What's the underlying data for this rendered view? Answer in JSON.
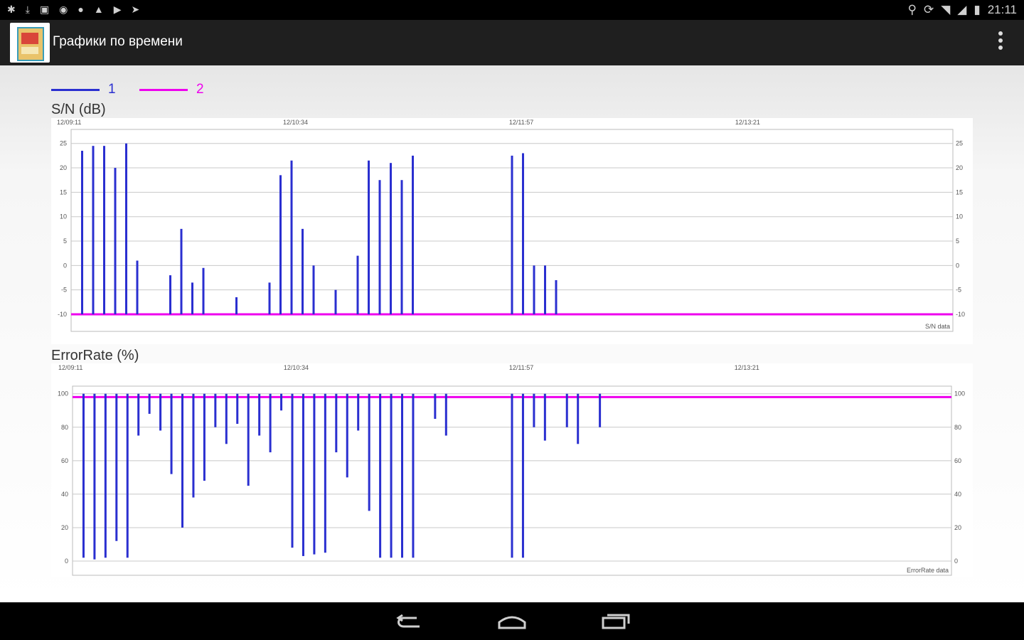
{
  "statusbar": {
    "time": "21:11",
    "left_icons": [
      "tools-icon",
      "download-icon",
      "app-icon",
      "gesture-icon",
      "dot-icon",
      "warning-icon",
      "play-icon",
      "send-icon"
    ],
    "right_icons": [
      "location-icon",
      "rotate-icon",
      "wifi-icon",
      "signal-icon",
      "battery-icon"
    ]
  },
  "appbar": {
    "title": "Графики по времени"
  },
  "legend": [
    {
      "label": "1",
      "color": "#2a2fd0"
    },
    {
      "label": "2",
      "color": "#ee00ee"
    }
  ],
  "colors": {
    "series1": "#2a2fd0",
    "series2": "#ee00ee"
  },
  "chart_data": [
    {
      "type": "bar",
      "title": "S/N (dB)",
      "footer_label": "S/N data",
      "time_labels": [
        "12/09:11",
        "12/10:34",
        "12/11:57",
        "12/13:21"
      ],
      "ylim": [
        -10,
        27
      ],
      "yticks": [
        25,
        20,
        15,
        10,
        5,
        0,
        -5,
        -10
      ],
      "ytick_labels": [
        "25",
        "20",
        "15",
        "10",
        "5",
        "0",
        "-5",
        "-10"
      ],
      "grid": true,
      "legend": "top-left",
      "x_count": 80,
      "series": [
        {
          "name": "1",
          "type": "bar",
          "x": [
            1,
            2,
            3,
            4,
            5,
            6,
            9,
            10,
            11,
            12,
            15,
            18,
            19,
            20,
            21,
            22,
            24,
            26,
            27,
            28,
            29,
            30,
            31,
            40,
            41,
            42,
            43,
            44
          ],
          "values": [
            23.5,
            24.5,
            24.5,
            20,
            25,
            1,
            -2,
            7.5,
            -3.5,
            -0.5,
            -6.5,
            -3.5,
            18.5,
            21.5,
            7.5,
            0,
            -5,
            2,
            21.5,
            17.5,
            21,
            17.5,
            22.5,
            22.5,
            23,
            0,
            0,
            -3
          ]
        },
        {
          "name": "2",
          "type": "line",
          "x": [
            0,
            80
          ],
          "values": [
            -10,
            -10
          ]
        }
      ]
    },
    {
      "type": "bar",
      "title": "ErrorRate (%)",
      "footer_label": "ErrorRate data",
      "time_labels": [
        "12/09:11",
        "12/10:34",
        "12/11:57",
        "12/13:21"
      ],
      "ylim": [
        0,
        102
      ],
      "yticks": [
        100,
        80,
        60,
        40,
        20,
        0
      ],
      "ytick_labels": [
        "100",
        "80",
        "60",
        "40",
        "20",
        "0"
      ],
      "grid": true,
      "x_count": 80,
      "series": [
        {
          "name": "1",
          "type": "bar",
          "x": [
            1,
            2,
            3,
            4,
            5,
            6,
            7,
            8,
            9,
            10,
            11,
            12,
            13,
            14,
            15,
            16,
            17,
            18,
            19,
            20,
            21,
            22,
            23,
            24,
            25,
            26,
            27,
            28,
            29,
            30,
            31,
            33,
            34,
            40,
            41,
            42,
            43,
            45,
            46,
            48
          ],
          "values": [
            2,
            1,
            2,
            12,
            2,
            75,
            88,
            78,
            52,
            20,
            38,
            48,
            80,
            70,
            82,
            45,
            75,
            65,
            90,
            8,
            3,
            4,
            5,
            65,
            50,
            78,
            30,
            2,
            2,
            2,
            2,
            85,
            75,
            2,
            2,
            80,
            72,
            80,
            70,
            80
          ]
        },
        {
          "name": "2",
          "type": "line",
          "x": [
            0,
            80
          ],
          "values": [
            98,
            98
          ]
        }
      ]
    }
  ]
}
